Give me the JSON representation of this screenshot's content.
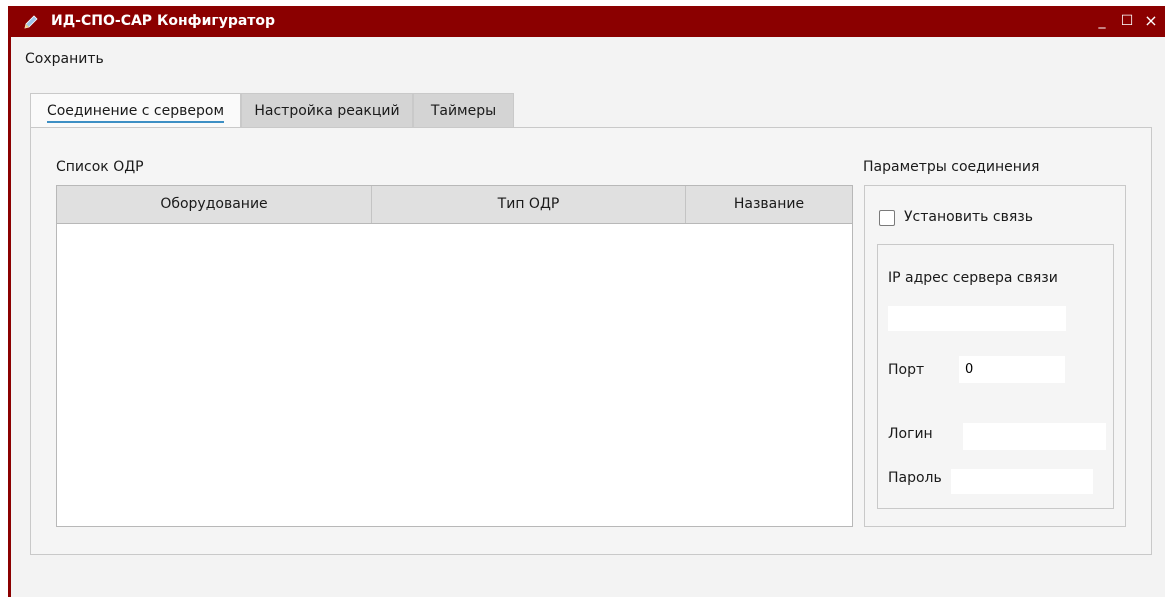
{
  "window": {
    "title": "ИД-СПО-САР Конфигуратор",
    "controls": {
      "minimize": "_",
      "maximize": "☐",
      "close": "×"
    },
    "accent_color": "#8b0000"
  },
  "menu": {
    "save_label": "Сохранить"
  },
  "tabs": [
    {
      "label": "Соединение с сервером",
      "active": true
    },
    {
      "label": "Настройка реакций",
      "active": false
    },
    {
      "label": "Таймеры",
      "active": false
    }
  ],
  "odr_list": {
    "label": "Список ОДР",
    "columns": [
      "Оборудование",
      "Тип ОДР",
      "Название"
    ],
    "rows": []
  },
  "connection": {
    "label": "Параметры соединения",
    "establish_link_label": "Установить связь",
    "establish_link_checked": false,
    "ip_label": "IP адрес сервера связи",
    "ip_value": "",
    "port_label": "Порт",
    "port_value": "0",
    "login_label": "Логин",
    "login_value": "",
    "password_label": "Пароль",
    "password_value": ""
  }
}
